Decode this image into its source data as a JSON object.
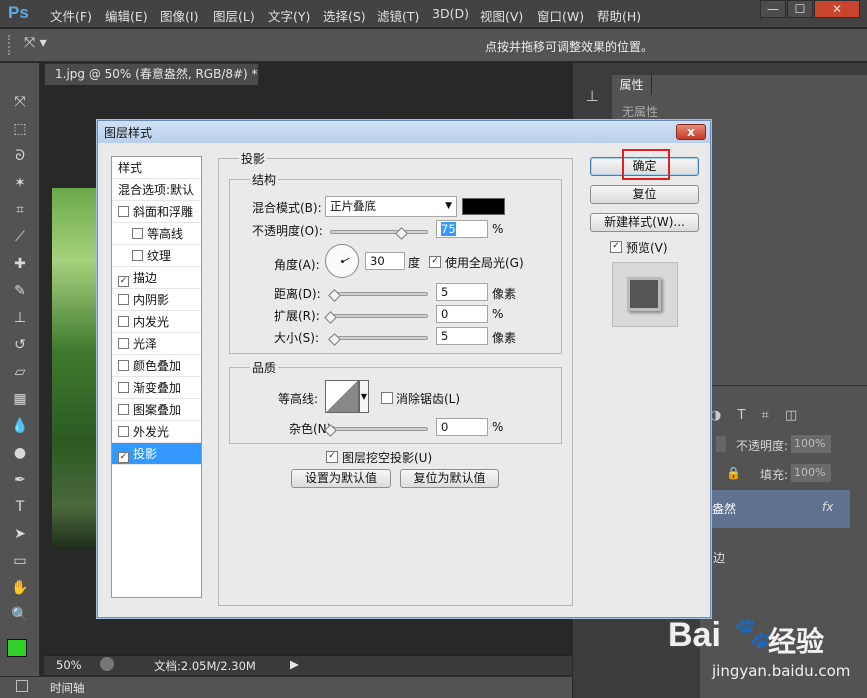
{
  "app": {
    "logo": "Ps"
  },
  "menu": [
    "文件(F)",
    "编辑(E)",
    "图像(I)",
    "图层(L)",
    "文字(Y)",
    "选择(S)",
    "滤镜(T)",
    "3D(D)",
    "视图(V)",
    "窗口(W)",
    "帮助(H)"
  ],
  "options_bar": {
    "hint": "点按并拖移可调整效果的位置。"
  },
  "document": {
    "tab_title": "1.jpg @ 50% (春意盎然, RGB/8#) *",
    "close": "×"
  },
  "status": {
    "zoom": "50%",
    "doc_size": "文档:2.05M/2.30M"
  },
  "timeline": {
    "label": "时间轴"
  },
  "properties": {
    "tab": "属性",
    "empty": "无属性"
  },
  "layers": {
    "opacity_label": "不透明度:",
    "opacity_value": "100%",
    "fill_label": "填充:",
    "fill_value": "100%",
    "layer_name": "盎然",
    "fx": "fx",
    "sub_effect": "边"
  },
  "dialog": {
    "title": "图层样式",
    "close": "x",
    "styles": [
      {
        "label": "样式",
        "check": "none"
      },
      {
        "label": "混合选项:默认",
        "check": "none"
      },
      {
        "label": "斜面和浮雕",
        "check": "off"
      },
      {
        "label": "等高线",
        "check": "off",
        "indent": true
      },
      {
        "label": "纹理",
        "check": "off",
        "indent": true
      },
      {
        "label": "描边",
        "check": "on"
      },
      {
        "label": "内阴影",
        "check": "off"
      },
      {
        "label": "内发光",
        "check": "off"
      },
      {
        "label": "光泽",
        "check": "off"
      },
      {
        "label": "颜色叠加",
        "check": "off"
      },
      {
        "label": "渐变叠加",
        "check": "off"
      },
      {
        "label": "图案叠加",
        "check": "off"
      },
      {
        "label": "外发光",
        "check": "off"
      },
      {
        "label": "投影",
        "check": "on",
        "selected": true
      }
    ],
    "section_title": "投影",
    "structure": {
      "title": "结构",
      "blend_label": "混合模式(B):",
      "blend_value": "正片叠底",
      "blend_color": "#000000",
      "opacity_label": "不透明度(O):",
      "opacity_value": "75",
      "opacity_pct": 0.75,
      "percent": "%",
      "angle_label": "角度(A):",
      "angle_value": "30",
      "degree": "度",
      "global_light": "使用全局光(G)",
      "distance_label": "距离(D):",
      "distance_value": "5",
      "spread_label": "扩展(R):",
      "spread_value": "0",
      "size_label": "大小(S):",
      "size_value": "5",
      "px_unit": "像素"
    },
    "quality": {
      "title": "品质",
      "contour_label": "等高线:",
      "antialias": "消除锯齿(L)",
      "noise_label": "杂色(N):",
      "noise_value": "0",
      "percent": "%"
    },
    "knockout": "图层挖空投影(U)",
    "set_default": "设置为默认值",
    "reset_default": "复位为默认值",
    "ok": "确定",
    "reset": "复位",
    "new_style": "新建样式(W)...",
    "preview": "预览(V)"
  },
  "watermark": {
    "brand": "Bai",
    "brand_cn": "经验",
    "url": "jingyan.baidu.com"
  }
}
